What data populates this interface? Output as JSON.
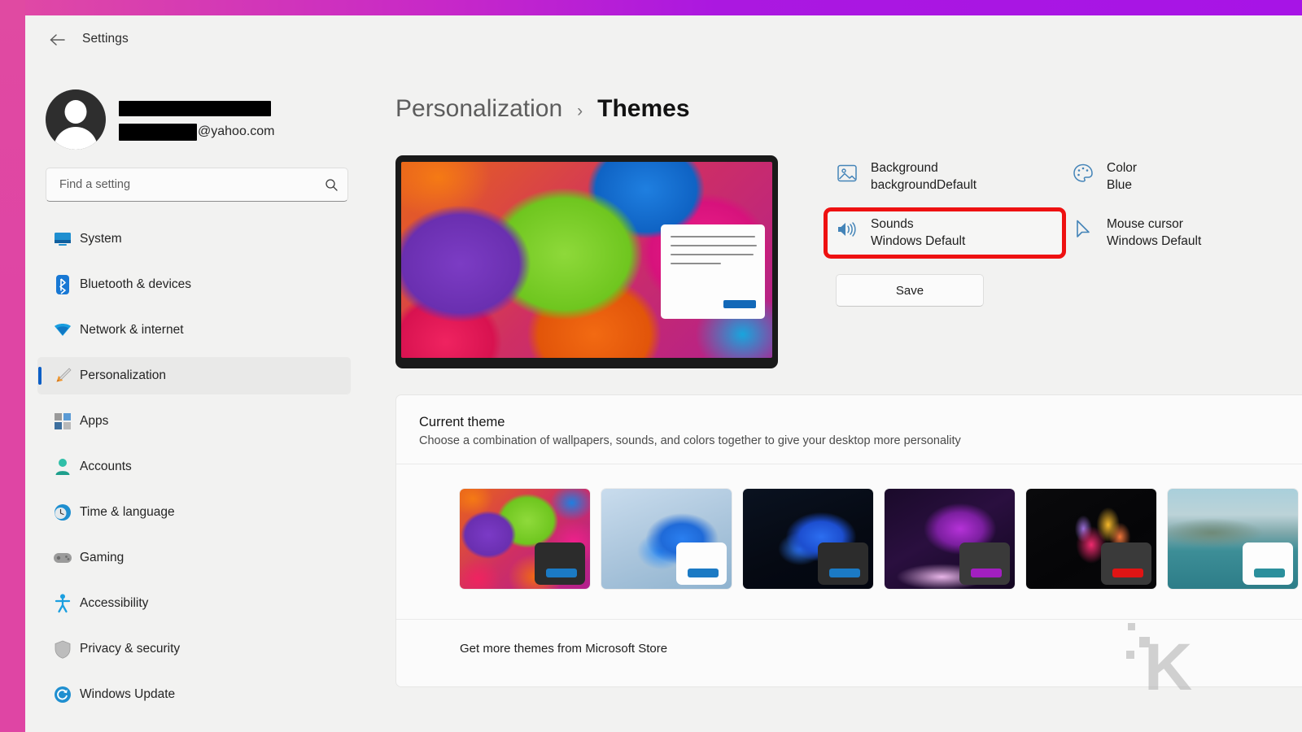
{
  "window": {
    "app_title": "Settings",
    "back_icon": "back-arrow-icon"
  },
  "account": {
    "name_redacted": true,
    "email_domain": "@yahoo.com",
    "avatar_icon": "user-avatar-icon"
  },
  "search": {
    "placeholder": "Find a setting",
    "value": "",
    "icon": "search-icon"
  },
  "sidebar": {
    "items": [
      {
        "label": "System",
        "icon": "monitor-icon",
        "selected": false
      },
      {
        "label": "Bluetooth & devices",
        "icon": "bluetooth-icon",
        "selected": false
      },
      {
        "label": "Network & internet",
        "icon": "wifi-icon",
        "selected": false
      },
      {
        "label": "Personalization",
        "icon": "paintbrush-icon",
        "selected": true
      },
      {
        "label": "Apps",
        "icon": "apps-grid-icon",
        "selected": false
      },
      {
        "label": "Accounts",
        "icon": "person-icon",
        "selected": false
      },
      {
        "label": "Time & language",
        "icon": "clock-globe-icon",
        "selected": false
      },
      {
        "label": "Gaming",
        "icon": "gamepad-icon",
        "selected": false
      },
      {
        "label": "Accessibility",
        "icon": "accessibility-icon",
        "selected": false
      },
      {
        "label": "Privacy & security",
        "icon": "shield-icon",
        "selected": false
      },
      {
        "label": "Windows Update",
        "icon": "update-icon",
        "selected": false
      }
    ]
  },
  "breadcrumb": {
    "parent": "Personalization",
    "separator": "›",
    "current": "Themes"
  },
  "preview": {
    "device_name": "theme-preview-device",
    "wallpaper": "colorful umbrellas"
  },
  "options": [
    {
      "title": "Background",
      "value": "backgroundDefault",
      "icon": "picture-icon",
      "highlighted": false
    },
    {
      "title": "Color",
      "value": "Blue",
      "icon": "palette-icon",
      "highlighted": false
    },
    {
      "title": "Sounds",
      "value": "Windows Default",
      "icon": "speaker-icon",
      "highlighted": true
    },
    {
      "title": "Mouse cursor",
      "value": "Windows Default",
      "icon": "cursor-icon",
      "highlighted": false
    }
  ],
  "save": {
    "label": "Save"
  },
  "current_theme": {
    "title": "Current theme",
    "subtitle": "Choose a combination of wallpapers, sounds, and colors together to give your desktop more personality",
    "thumbnails": [
      {
        "name": "umbrellas-theme",
        "style": "bg-umbrella",
        "accent": "#1b7ac4",
        "win_bg": "#2c2c2c"
      },
      {
        "name": "windows-light-theme",
        "style": "bg-bloom-light",
        "accent": "#1b7ac4",
        "win_bg": "#fdfdfd"
      },
      {
        "name": "windows-dark-theme",
        "style": "bg-bloom-dark",
        "accent": "#1b7ac4",
        "win_bg": "#2c2c2c"
      },
      {
        "name": "glow-theme",
        "style": "bg-glow-dark",
        "accent": "#a21fc0",
        "win_bg": "#2c2c2c"
      },
      {
        "name": "flow-theme",
        "style": "bg-flow-dark",
        "accent": "#e01414",
        "win_bg": "#2c2c2c"
      },
      {
        "name": "captured-motion-theme",
        "style": "bg-captured",
        "accent": "#2b8f9c",
        "win_bg": "#fdfdfd"
      }
    ]
  },
  "get_more": {
    "label": "Get more themes from Microsoft Store"
  },
  "colors": {
    "accent": "#0d5fc6",
    "highlight_box": "#ee1111",
    "frame_pink": "#df45a4",
    "frame_purple": "#a714e6",
    "window_bg": "#f2f2f1",
    "card_bg": "#fbfbfb"
  },
  "watermark": {
    "letter": "K"
  }
}
